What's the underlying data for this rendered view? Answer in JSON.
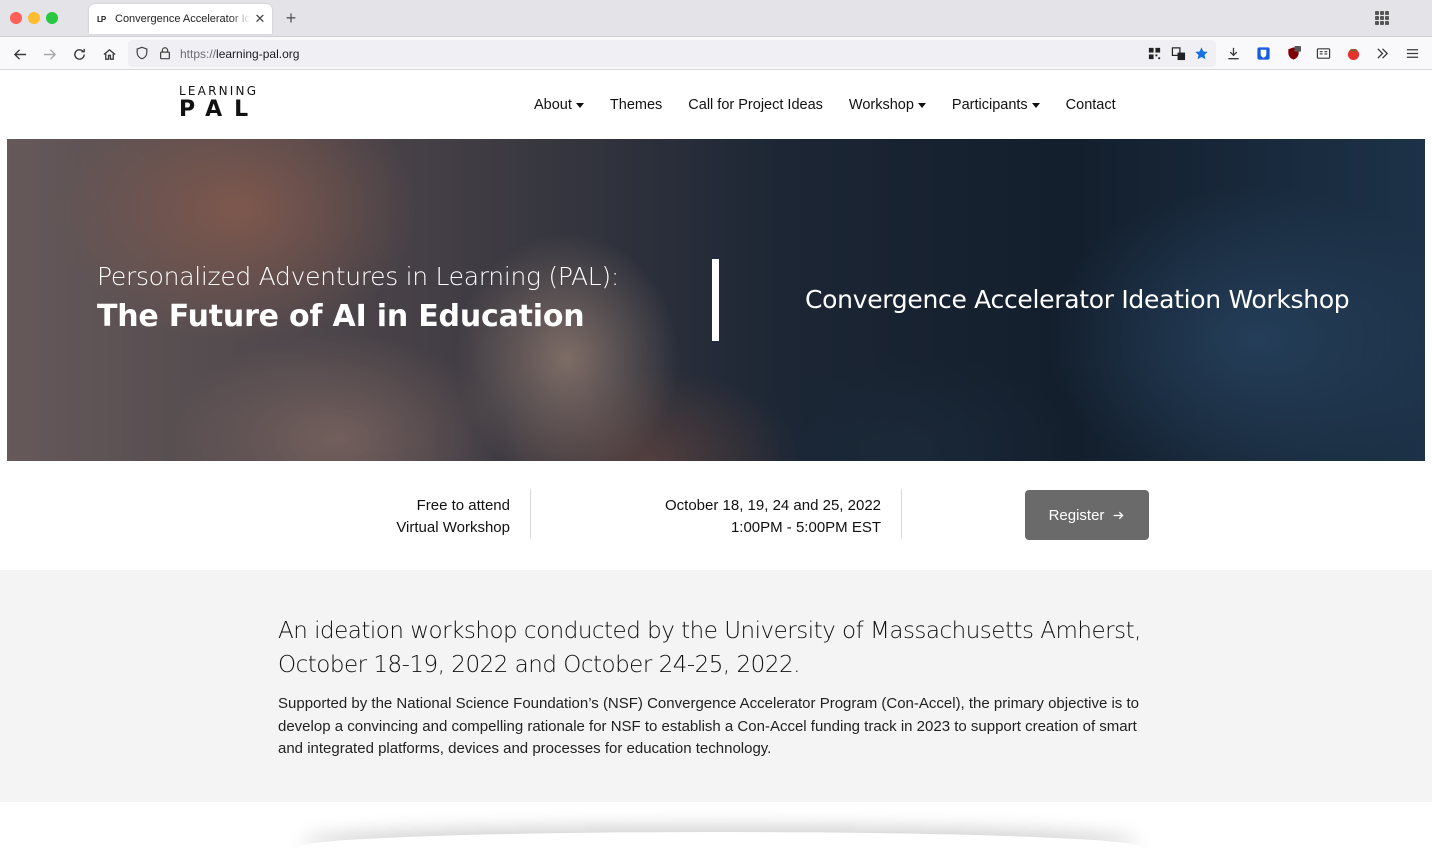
{
  "browser": {
    "tab_title": "Convergence Accelerator Ideation Workshop",
    "tab_favicon": "LP",
    "url_protocol": "https://",
    "url_host": "learning-pal.org"
  },
  "site": {
    "logo_top": "LEARNING",
    "logo_bottom": "PAL",
    "nav": [
      {
        "label": "About",
        "dropdown": true
      },
      {
        "label": "Themes",
        "dropdown": false
      },
      {
        "label": "Call for Project Ideas",
        "dropdown": false
      },
      {
        "label": "Workshop",
        "dropdown": true
      },
      {
        "label": "Participants",
        "dropdown": true
      },
      {
        "label": "Contact",
        "dropdown": false
      }
    ]
  },
  "hero": {
    "subtitle": "Personalized Adventures in Learning (PAL):",
    "title": "The Future of AI in Education",
    "right_title": "Convergence Accelerator Ideation Workshop"
  },
  "info": {
    "cost": "Free to attend",
    "format": "Virtual Workshop",
    "dates": "October 18, 19, 24 and 25, 2022",
    "time": "1:00PM - 5:00PM EST",
    "register_label": "Register"
  },
  "description": {
    "lead": "An ideation workshop conducted by the University of Massachusetts Amherst, October 18-19, 2022 and October 24-25, 2022.",
    "body": "Supported by the National Science Foundation’s (NSF) Convergence Accelerator Program (Con-Accel), the primary objective is to develop a convincing and compelling rationale for NSF to establish a Con-Accel funding track in 2023 to support creation of smart and integrated platforms, devices and processes for education technology."
  },
  "colors": {
    "register_bg": "#6a6a6a",
    "bookmark_star": "#1a6fe0",
    "description_bg": "#f4f4f4"
  }
}
